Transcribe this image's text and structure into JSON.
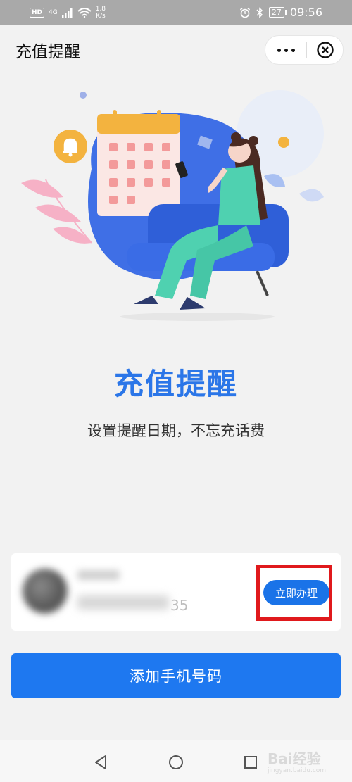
{
  "status_bar": {
    "hd": "HD",
    "network": "4G",
    "speed": "1.8\nK/s",
    "battery": "27",
    "time": "09:56"
  },
  "header": {
    "title": "充值提醒"
  },
  "hero": {
    "title": "充值提醒",
    "subtitle": "设置提醒日期，不忘充话费"
  },
  "card": {
    "phone_tail": "35",
    "action_label": "立即办理"
  },
  "add_button_label": "添加手机号码",
  "watermark": {
    "brand": "Bai经验",
    "url": "jingyan.baidu.com"
  },
  "colors": {
    "accent": "#2b76e8",
    "button": "#1e78f0",
    "highlight": "#e0191c"
  },
  "icons": [
    "more-icon",
    "close-icon",
    "back-icon",
    "home-icon",
    "recent-apps-icon",
    "alarm-icon",
    "bluetooth-icon",
    "wifi-icon",
    "signal-icon",
    "bell-icon"
  ]
}
